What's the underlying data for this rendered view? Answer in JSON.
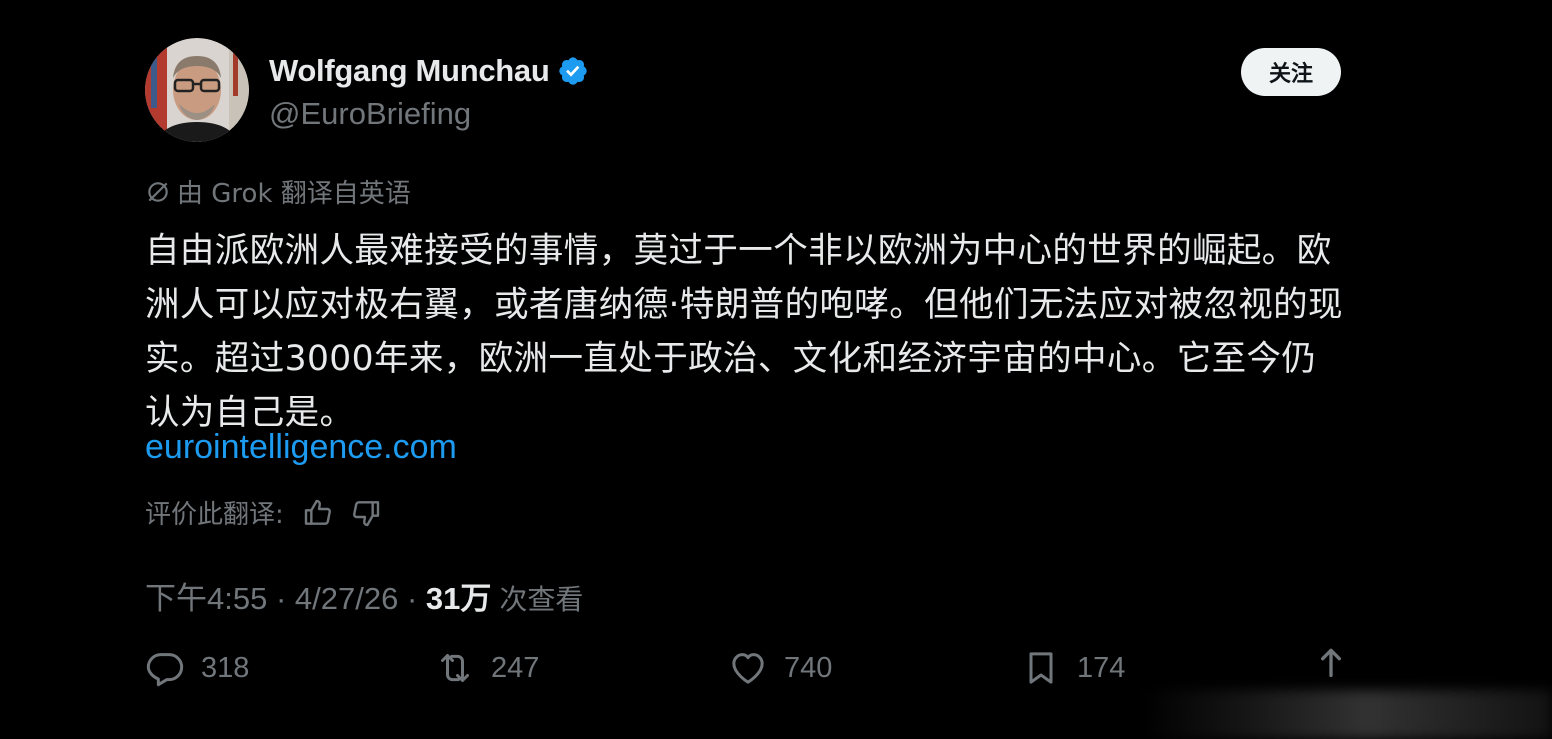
{
  "author": {
    "display_name": "Wolfgang Munchau",
    "handle": "@EuroBriefing",
    "verified": true
  },
  "follow_button": {
    "label": "关注"
  },
  "translation": {
    "label": "由 Grok 翻译自英语",
    "rate_label": "评价此翻译:"
  },
  "tweet": {
    "text": "自由派欧洲人最难接受的事情，莫过于一个非以欧洲为中心的世界的崛起。欧洲人可以应对极右翼，或者唐纳德·特朗普的咆哮。但他们无法应对被忽视的现实。超过3000年来，欧洲一直处于政治、文化和经济宇宙的中心。它至今仍认为自己是。",
    "link": "eurointelligence.com"
  },
  "meta": {
    "time": "下午4:55",
    "separator1": " · ",
    "date": "4/27/26",
    "separator2": " · ",
    "views_count": "31万",
    "views_label": "次查看"
  },
  "actions": {
    "replies": "318",
    "retweets": "247",
    "likes": "740",
    "bookmarks": "174"
  },
  "colors": {
    "background": "#000000",
    "text_primary": "#e7e9ea",
    "text_secondary": "#71767b",
    "link": "#1d9bf0",
    "verified_badge": "#1d9bf0",
    "follow_bg": "#eff3f4"
  },
  "icons": {
    "verified": "verified-badge-icon",
    "grok": "grok-icon",
    "thumbs_up": "thumbs-up-icon",
    "thumbs_down": "thumbs-down-icon",
    "reply": "reply-icon",
    "retweet": "retweet-icon",
    "like": "heart-icon",
    "bookmark": "bookmark-icon",
    "share": "share-icon"
  }
}
